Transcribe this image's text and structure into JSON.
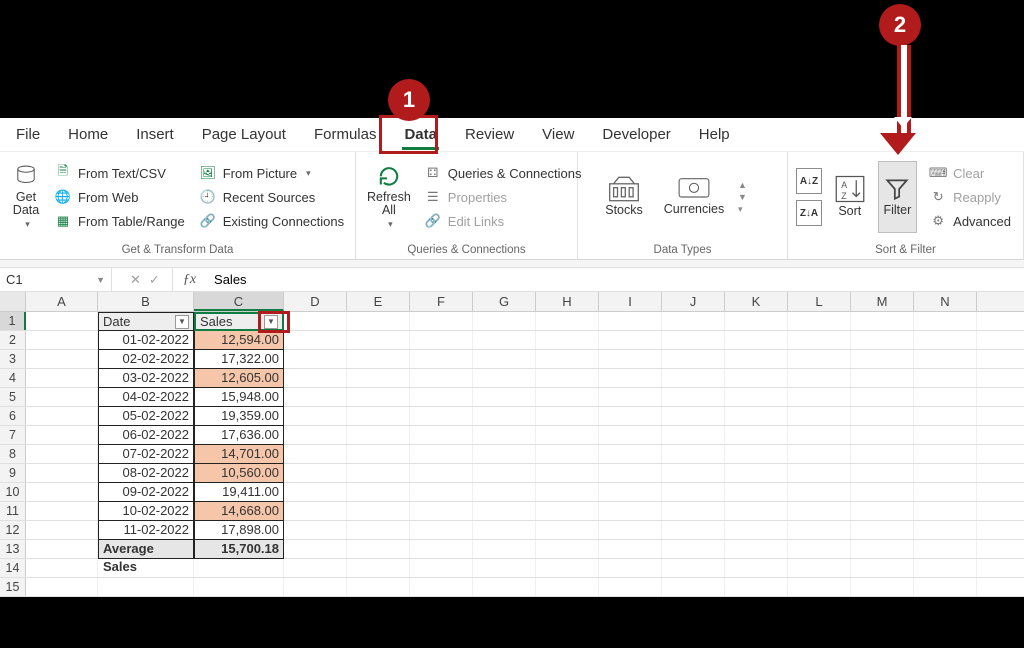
{
  "callouts": {
    "one": "1",
    "two": "2"
  },
  "tabs": [
    "File",
    "Home",
    "Insert",
    "Page Layout",
    "Formulas",
    "Data",
    "Review",
    "View",
    "Developer",
    "Help"
  ],
  "active_tab": "Data",
  "groups": {
    "get_transform": {
      "label": "Get & Transform Data",
      "get_data": "Get Data",
      "from_text_csv": "From Text/CSV",
      "from_web": "From Web",
      "from_table_range": "From Table/Range",
      "from_picture": "From Picture",
      "recent_sources": "Recent Sources",
      "existing_connections": "Existing Connections"
    },
    "queries": {
      "label": "Queries & Connections",
      "refresh_all": "Refresh All",
      "queries_conn": "Queries & Connections",
      "properties": "Properties",
      "edit_links": "Edit Links"
    },
    "data_types": {
      "label": "Data Types",
      "stocks": "Stocks",
      "currencies": "Currencies"
    },
    "sort_filter": {
      "label": "Sort & Filter",
      "sort": "Sort",
      "filter": "Filter",
      "clear": "Clear",
      "reapply": "Reapply",
      "advanced": "Advanced"
    }
  },
  "cell_ref": "C1",
  "formula_value": "Sales",
  "columns": [
    "A",
    "B",
    "C",
    "D",
    "E",
    "F",
    "G",
    "H",
    "I",
    "J",
    "K",
    "L",
    "M",
    "N"
  ],
  "headers": {
    "date": "Date",
    "sales": "Sales"
  },
  "rows": [
    {
      "date": "01-02-2022",
      "sales": "12,594.00",
      "hl": true
    },
    {
      "date": "02-02-2022",
      "sales": "17,322.00",
      "hl": false
    },
    {
      "date": "03-02-2022",
      "sales": "12,605.00",
      "hl": true
    },
    {
      "date": "04-02-2022",
      "sales": "15,948.00",
      "hl": false
    },
    {
      "date": "05-02-2022",
      "sales": "19,359.00",
      "hl": false
    },
    {
      "date": "06-02-2022",
      "sales": "17,636.00",
      "hl": false
    },
    {
      "date": "07-02-2022",
      "sales": "14,701.00",
      "hl": true
    },
    {
      "date": "08-02-2022",
      "sales": "10,560.00",
      "hl": true
    },
    {
      "date": "09-02-2022",
      "sales": "19,411.00",
      "hl": false
    },
    {
      "date": "10-02-2022",
      "sales": "14,668.00",
      "hl": true
    },
    {
      "date": "11-02-2022",
      "sales": "17,898.00",
      "hl": false
    }
  ],
  "avg": {
    "label": "Average Sales",
    "value": "15,700.18"
  },
  "chart_data": {
    "type": "table",
    "title": "Sales by date with highlighted below-average values",
    "columns": [
      "Date",
      "Sales"
    ],
    "rows": [
      [
        "01-02-2022",
        12594.0
      ],
      [
        "02-02-2022",
        17322.0
      ],
      [
        "03-02-2022",
        12605.0
      ],
      [
        "04-02-2022",
        15948.0
      ],
      [
        "05-02-2022",
        19359.0
      ],
      [
        "06-02-2022",
        17636.0
      ],
      [
        "07-02-2022",
        14701.0
      ],
      [
        "08-02-2022",
        10560.0
      ],
      [
        "09-02-2022",
        19411.0
      ],
      [
        "10-02-2022",
        14668.0
      ],
      [
        "11-02-2022",
        17898.0
      ]
    ],
    "highlighted_rows": [
      0,
      2,
      6,
      7,
      9
    ],
    "summary": {
      "Average Sales": 15700.18
    }
  }
}
